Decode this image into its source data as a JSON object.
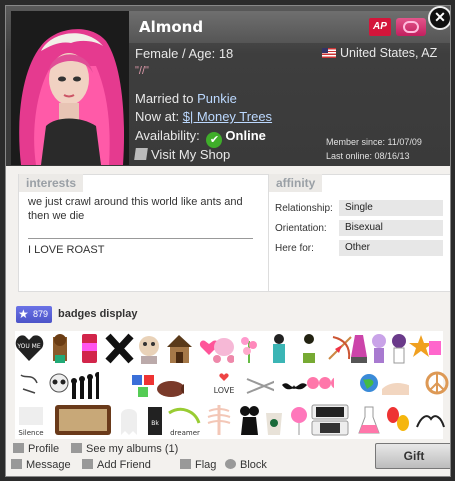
{
  "profile": {
    "name": "Almond",
    "gender_age": "Female  / Age: 18",
    "location": "United States, AZ",
    "tagline": "ʺ//ʺ",
    "married_prefix": "Married to ",
    "married_to": "Punkie",
    "now_at_prefix": "Now at: ",
    "now_at": "$| Money Trees",
    "availability_label": "Availability:",
    "availability": "Online",
    "shop": "Visit My Shop",
    "member_since": "Member since: 11/07/09",
    "last_online": "Last online: 08/16/13",
    "ap_badge": "AP"
  },
  "interests": {
    "title": "interests",
    "text": "we just crawl around this world like ants and then we die",
    "text2": "I LOVE ROAST"
  },
  "affinity": {
    "title": "affinity",
    "rows": [
      {
        "label": "Relationship:",
        "value": "Single"
      },
      {
        "label": "Orientation:",
        "value": "Bisexual"
      },
      {
        "label": "Here for:",
        "value": "Other"
      }
    ]
  },
  "badges": {
    "count": "879",
    "title": "badges display",
    "labels": [
      "YOU ME",
      "LOVE",
      "Silence",
      "dreamer",
      "Bk"
    ]
  },
  "footer": {
    "profile": "Profile",
    "albums": "See my albums (1)",
    "message": "Message",
    "add_friend": "Add Friend",
    "flag": "Flag",
    "block": "Block",
    "gift": "Gift"
  },
  "colors": {
    "header_bg": "#3e3e3e",
    "link": "#bcd9ff",
    "online": "#3fae2a",
    "ap": "#d4153a",
    "badge_count": "#5b63d8"
  }
}
